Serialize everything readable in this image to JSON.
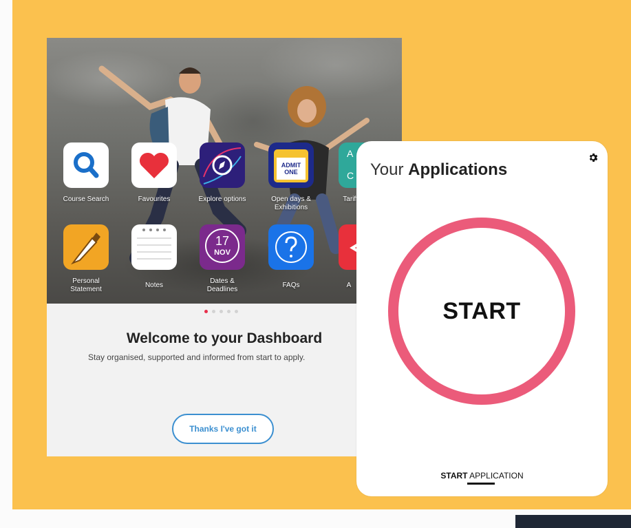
{
  "dashboard": {
    "apps_row1": [
      {
        "label": "Course Search",
        "icon": "search-icon",
        "color": "#ffffff"
      },
      {
        "label": "Favourites",
        "icon": "heart-icon",
        "color": "#ffffff"
      },
      {
        "label": "Explore options",
        "icon": "compass-icon",
        "color": "#2d1f7a"
      },
      {
        "label": "Open days & Exhibitions",
        "icon": "ticket-icon",
        "color": "#1d2a8a"
      },
      {
        "label": "Tariff Predict",
        "icon": "tariff-icon",
        "color": "#2fa89a"
      }
    ],
    "apps_row2": [
      {
        "label": "Personal Statement",
        "icon": "pen-icon",
        "color": "#f2a524"
      },
      {
        "label": "Notes",
        "icon": "notes-icon",
        "color": "#ffffff"
      },
      {
        "label": "Dates & Deadlines",
        "icon": "calendar-icon",
        "color": "#7b2a8c"
      },
      {
        "label": "FAQs",
        "icon": "question-icon",
        "color": "#1a73e8"
      },
      {
        "label": "A",
        "icon": "share-icon",
        "color": "#e8303b"
      }
    ],
    "ticket_text": "ADMIT ONE",
    "calendar_day": "17",
    "calendar_month": "NOV",
    "tariff_letters": [
      "A",
      "C"
    ],
    "welcome_title": "Welcome to your Dashboard",
    "welcome_subtitle": "Stay organised, supported and informed from start to apply.",
    "thanks_button": "Thanks I've got it",
    "page_dots": 5,
    "active_dot": 0
  },
  "applications": {
    "title_regular": "Your",
    "title_bold": "Applications",
    "start_ring_label": "START",
    "tab_bold": "START",
    "tab_regular": "APPLICATION",
    "ring_color": "#eb5b7a"
  },
  "colors": {
    "background": "#fbc14e",
    "accent_blue": "#3b8fd0",
    "active_dot": "#e8304c"
  }
}
